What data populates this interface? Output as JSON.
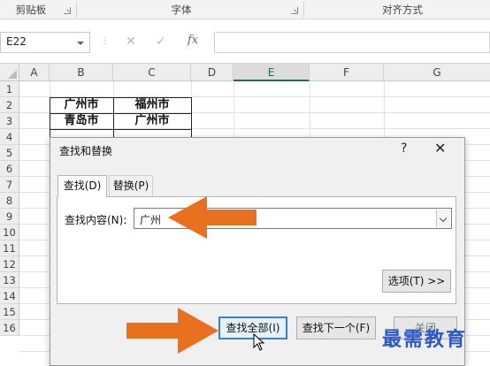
{
  "ribbon": {
    "groups": [
      {
        "label": "剪贴板"
      },
      {
        "label": "字体"
      },
      {
        "label": "对齐方式"
      }
    ]
  },
  "formula_bar": {
    "name_box": "E22",
    "fx_label": "fx",
    "value": ""
  },
  "sheet": {
    "columns": [
      "A",
      "B",
      "C",
      "D",
      "E",
      "F",
      "G"
    ],
    "selected_column": "E",
    "rows": [
      "1",
      "2",
      "3",
      "4",
      "5",
      "6",
      "7",
      "8",
      "9",
      "10",
      "11",
      "12",
      "13",
      "14",
      "15",
      "16"
    ],
    "cells": [
      {
        "ref": "B2",
        "value": "广州市"
      },
      {
        "ref": "C2",
        "value": "福州市"
      },
      {
        "ref": "B3",
        "value": "青岛市"
      },
      {
        "ref": "C3",
        "value": "广州市"
      }
    ]
  },
  "dialog": {
    "title": "查找和替换",
    "help": "?",
    "close": "✕",
    "tabs": [
      {
        "label": "查找(D)",
        "active": true
      },
      {
        "label": "替换(P)",
        "active": false
      }
    ],
    "find_label": "查找内容(N):",
    "find_value": "广州",
    "options_button": "选项(T) >>",
    "find_all_button": "查找全部(I)",
    "find_next_button": "查找下一个(F)",
    "close_button": "关闭"
  },
  "watermark": "最需教育",
  "colors": {
    "accent_arrow": "#e8701f",
    "excel_green": "#217346",
    "watermark": "#2c57c4"
  }
}
